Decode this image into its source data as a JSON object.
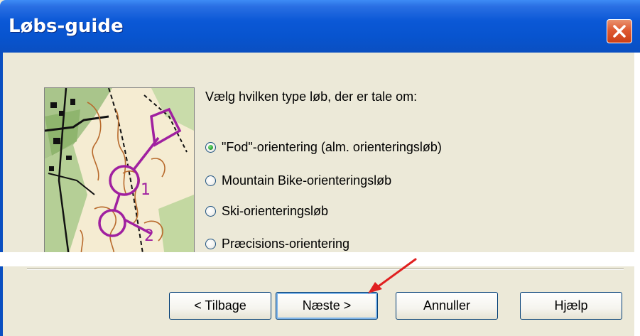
{
  "window": {
    "title": "Løbs-guide",
    "close_icon": "close-icon"
  },
  "main": {
    "prompt": "Vælg hvilken type løb, der er tale om:",
    "options": [
      {
        "label": "\"Fod\"-orientering  (alm. orienteringsløb)",
        "checked": true
      },
      {
        "label": "Mountain Bike-orienteringsløb",
        "checked": false
      },
      {
        "label": "Ski-orienteringsløb",
        "checked": false
      },
      {
        "label": "Præcisions-orientering",
        "checked": false
      }
    ]
  },
  "buttons": {
    "back": "< Tilbage",
    "next": "Næste >",
    "cancel": "Annuller",
    "help": "Hjælp"
  },
  "colors": {
    "titlebar": "#0854cf",
    "dialog_bg": "#ece9d8",
    "annotation_arrow": "#e02020"
  }
}
